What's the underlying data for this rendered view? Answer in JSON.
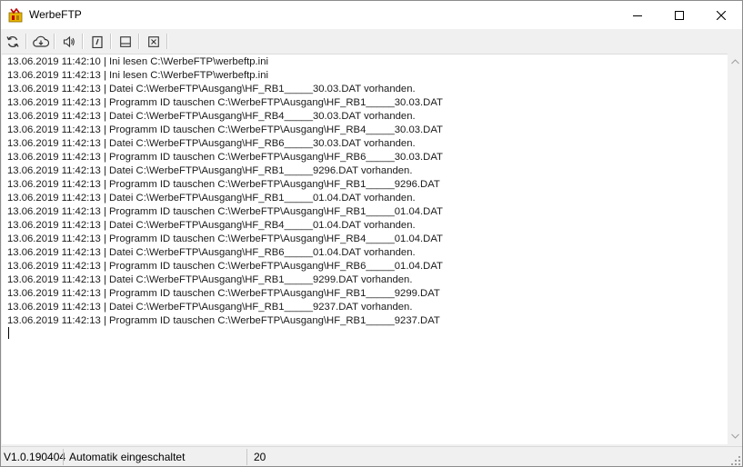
{
  "window": {
    "title": "WerbeFTP"
  },
  "toolbar": {
    "buttons": [
      {
        "name": "refresh-icon"
      },
      {
        "name": "cloud-download-icon"
      },
      {
        "name": "speaker-icon"
      },
      {
        "name": "clipboard-icon"
      },
      {
        "name": "window-icon"
      },
      {
        "name": "close-box-icon"
      }
    ]
  },
  "log": {
    "lines": [
      "13.06.2019 11:42:10 | Ini lesen C:\\WerbeFTP\\werbeftp.ini",
      "13.06.2019 11:42:13 | Ini lesen C:\\WerbeFTP\\werbeftp.ini",
      "13.06.2019 11:42:13 | Datei C:\\WerbeFTP\\Ausgang\\HF_RB1_____30.03.DAT vorhanden.",
      "13.06.2019 11:42:13 | Programm ID tauschen C:\\WerbeFTP\\Ausgang\\HF_RB1_____30.03.DAT",
      "13.06.2019 11:42:13 | Datei C:\\WerbeFTP\\Ausgang\\HF_RB4_____30.03.DAT vorhanden.",
      "13.06.2019 11:42:13 | Programm ID tauschen C:\\WerbeFTP\\Ausgang\\HF_RB4_____30.03.DAT",
      "13.06.2019 11:42:13 | Datei C:\\WerbeFTP\\Ausgang\\HF_RB6_____30.03.DAT vorhanden.",
      "13.06.2019 11:42:13 | Programm ID tauschen C:\\WerbeFTP\\Ausgang\\HF_RB6_____30.03.DAT",
      "13.06.2019 11:42:13 | Datei C:\\WerbeFTP\\Ausgang\\HF_RB1_____9296.DAT vorhanden.",
      "13.06.2019 11:42:13 | Programm ID tauschen C:\\WerbeFTP\\Ausgang\\HF_RB1_____9296.DAT",
      "13.06.2019 11:42:13 | Datei C:\\WerbeFTP\\Ausgang\\HF_RB1_____01.04.DAT vorhanden.",
      "13.06.2019 11:42:13 | Programm ID tauschen C:\\WerbeFTP\\Ausgang\\HF_RB1_____01.04.DAT",
      "13.06.2019 11:42:13 | Datei C:\\WerbeFTP\\Ausgang\\HF_RB4_____01.04.DAT vorhanden.",
      "13.06.2019 11:42:13 | Programm ID tauschen C:\\WerbeFTP\\Ausgang\\HF_RB4_____01.04.DAT",
      "13.06.2019 11:42:13 | Datei C:\\WerbeFTP\\Ausgang\\HF_RB6_____01.04.DAT vorhanden.",
      "13.06.2019 11:42:13 | Programm ID tauschen C:\\WerbeFTP\\Ausgang\\HF_RB6_____01.04.DAT",
      "13.06.2019 11:42:13 | Datei C:\\WerbeFTP\\Ausgang\\HF_RB1_____9299.DAT vorhanden.",
      "13.06.2019 11:42:13 | Programm ID tauschen C:\\WerbeFTP\\Ausgang\\HF_RB1_____9299.DAT",
      "13.06.2019 11:42:13 | Datei C:\\WerbeFTP\\Ausgang\\HF_RB1_____9237.DAT vorhanden.",
      "13.06.2019 11:42:13 | Programm ID tauschen C:\\WerbeFTP\\Ausgang\\HF_RB1_____9237.DAT"
    ]
  },
  "statusbar": {
    "version": "V1.0.190404",
    "mode": "Automatik eingeschaltet",
    "count": "20"
  }
}
